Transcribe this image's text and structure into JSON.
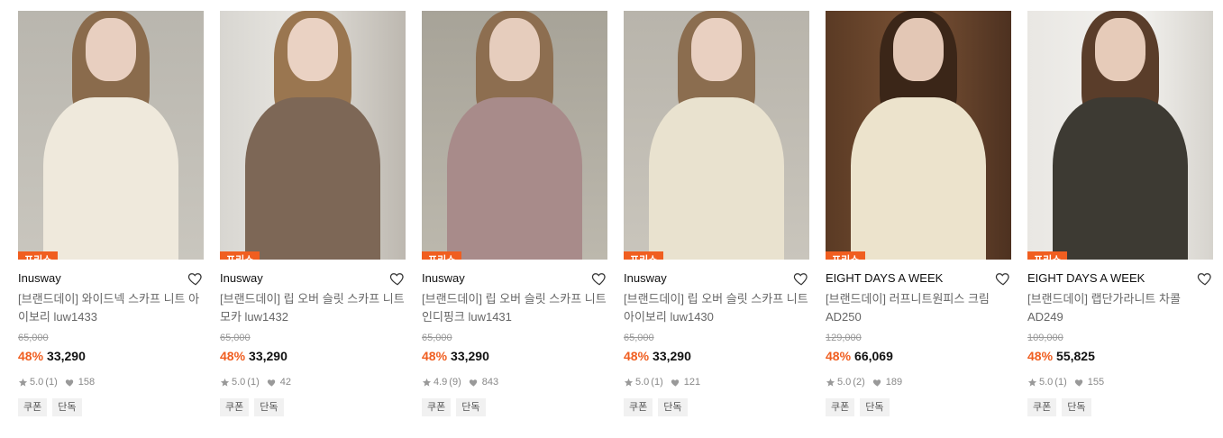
{
  "colors": {
    "accent": "#f05e20",
    "price": "#111111",
    "muted": "#999999"
  },
  "icons": {
    "wish": "heart-outline-icon",
    "rating": "star-icon",
    "likes": "heart-filled-icon"
  },
  "products": [
    {
      "badge": "프리쇼",
      "brand": "Inusway",
      "name": "[브랜드데이] 와이드넥 스카프 니트 아이보리 luw1433",
      "original_price": "65,000",
      "discount": "48%",
      "price": "33,290",
      "rating": "5.0",
      "reviews": "(1)",
      "likes": "158",
      "tags": [
        "쿠폰",
        "단독"
      ]
    },
    {
      "badge": "프리쇼",
      "brand": "Inusway",
      "name": "[브랜드데이] 립 오버 슬릿 스카프 니트 모카 luw1432",
      "original_price": "65,000",
      "discount": "48%",
      "price": "33,290",
      "rating": "5.0",
      "reviews": "(1)",
      "likes": "42",
      "tags": [
        "쿠폰",
        "단독"
      ]
    },
    {
      "badge": "프리쇼",
      "brand": "Inusway",
      "name": "[브랜드데이] 립 오버 슬릿 스카프 니트 인디핑크 luw1431",
      "original_price": "65,000",
      "discount": "48%",
      "price": "33,290",
      "rating": "4.9",
      "reviews": "(9)",
      "likes": "843",
      "tags": [
        "쿠폰",
        "단독"
      ]
    },
    {
      "badge": "프리쇼",
      "brand": "Inusway",
      "name": "[브랜드데이] 립 오버 슬릿 스카프 니트 아이보리 luw1430",
      "original_price": "65,000",
      "discount": "48%",
      "price": "33,290",
      "rating": "5.0",
      "reviews": "(1)",
      "likes": "121",
      "tags": [
        "쿠폰",
        "단독"
      ]
    },
    {
      "badge": "프리쇼",
      "brand": "EIGHT DAYS A WEEK",
      "name": "[브랜드데이] 러프니트원피스 크림 AD250",
      "original_price": "129,000",
      "discount": "48%",
      "price": "66,069",
      "rating": "5.0",
      "reviews": "(2)",
      "likes": "189",
      "tags": [
        "쿠폰",
        "단독"
      ]
    },
    {
      "badge": "프리쇼",
      "brand": "EIGHT DAYS A WEEK",
      "name": "[브랜드데이] 랩단가라니트 차콜 AD249",
      "original_price": "109,000",
      "discount": "48%",
      "price": "55,825",
      "rating": "5.0",
      "reviews": "(1)",
      "likes": "155",
      "tags": [
        "쿠폰",
        "단독"
      ]
    }
  ]
}
